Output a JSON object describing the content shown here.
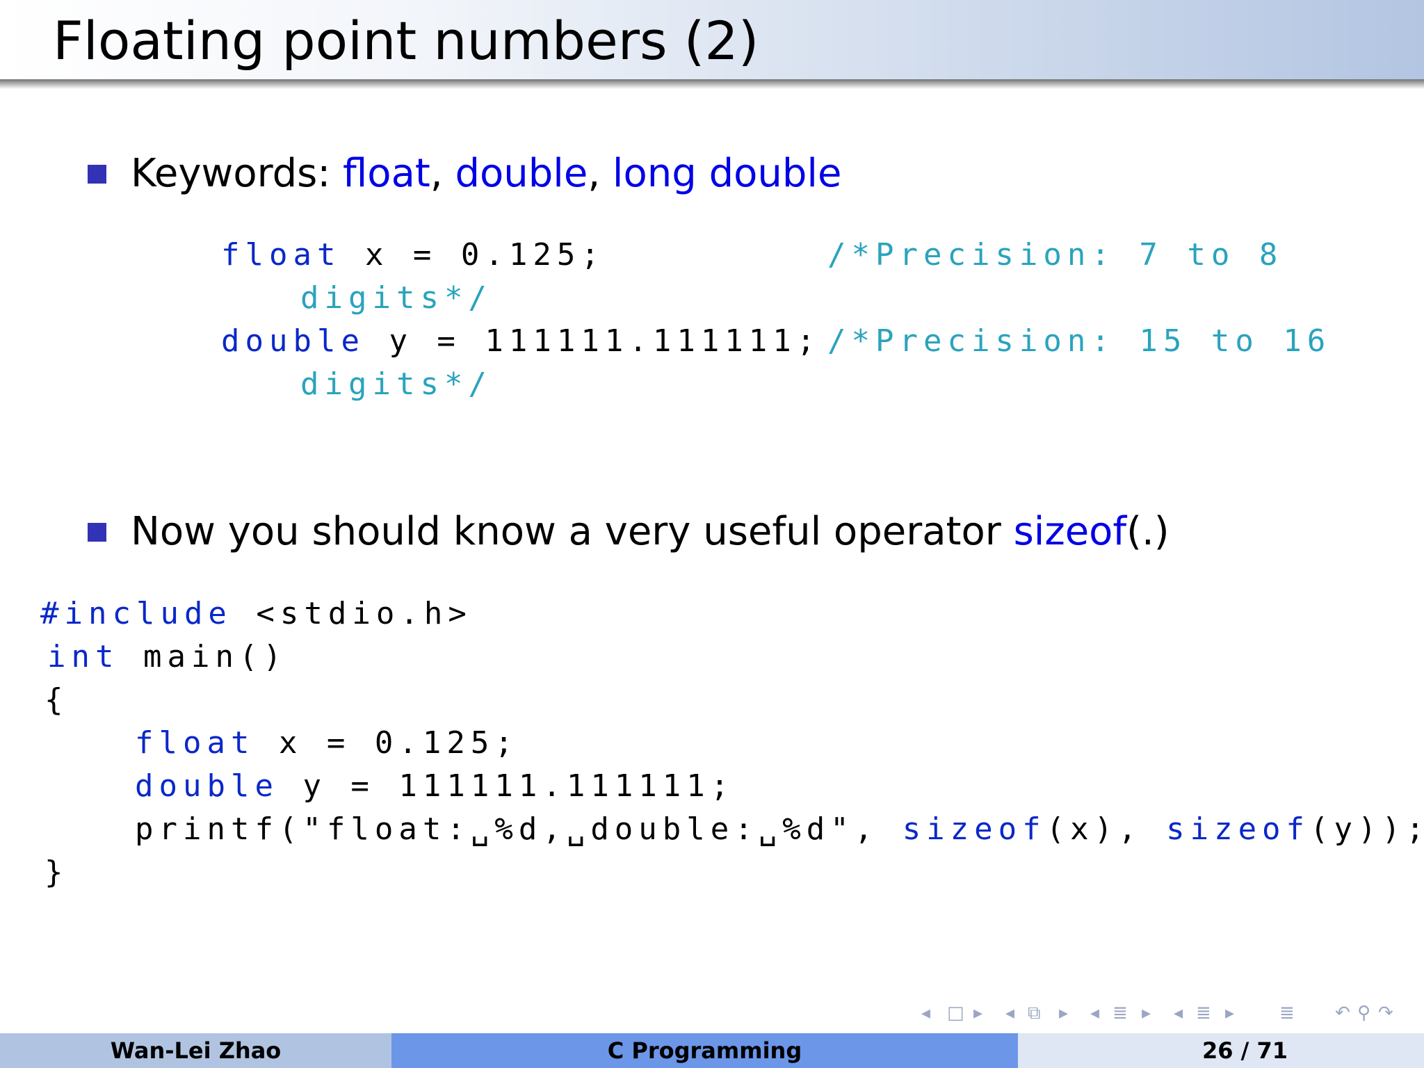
{
  "slide": {
    "title": "Floating point numbers (2)",
    "bullet1": {
      "prefix": "Keywords: ",
      "kw1": "float",
      "sep1": ", ",
      "kw2": "double",
      "sep2": ", ",
      "kw3": "long double"
    },
    "code1": {
      "line1": {
        "kw": "float",
        "rest": " x = 0.125;",
        "comment": "/*Precision: 7 to 8"
      },
      "line2": {
        "comment": "digits*/"
      },
      "line3": {
        "kw": "double",
        "rest": " y = 111111.111111;",
        "comment": "/*Precision: 15 to 16"
      },
      "line4": {
        "comment": "digits*/"
      }
    },
    "bullet2": {
      "prefix": "Now you should know a very useful operator ",
      "kw": "sizeof",
      "suffix": "(.)"
    },
    "code2": {
      "line1": {
        "kw": "#include",
        "rest": " <stdio.h>"
      },
      "line2": {
        "kw": "int",
        "rest": " main()"
      },
      "line3": "{",
      "line4": {
        "kw": "float",
        "rest": " x = 0.125;"
      },
      "line5": {
        "kw": "double",
        "rest": " y = 111111.111111;"
      },
      "line6": {
        "pre": "printf(\"float:␣%d,␣double:␣%d\", ",
        "kw1": "sizeof",
        "mid": "(x), ",
        "kw2": "sizeof",
        "post": "(y));"
      },
      "line7": "}"
    }
  },
  "footer": {
    "author": "Wan-Lei Zhao",
    "course": "C Programming",
    "page": "26 / 71"
  },
  "colors": {
    "accent": "#3232b6",
    "keyword_text": "#0000e6",
    "code_keyword": "#0a28c8",
    "code_comment": "#2aa3bd",
    "footer_left": "#b0c4e2",
    "footer_mid": "#6c96e8"
  }
}
